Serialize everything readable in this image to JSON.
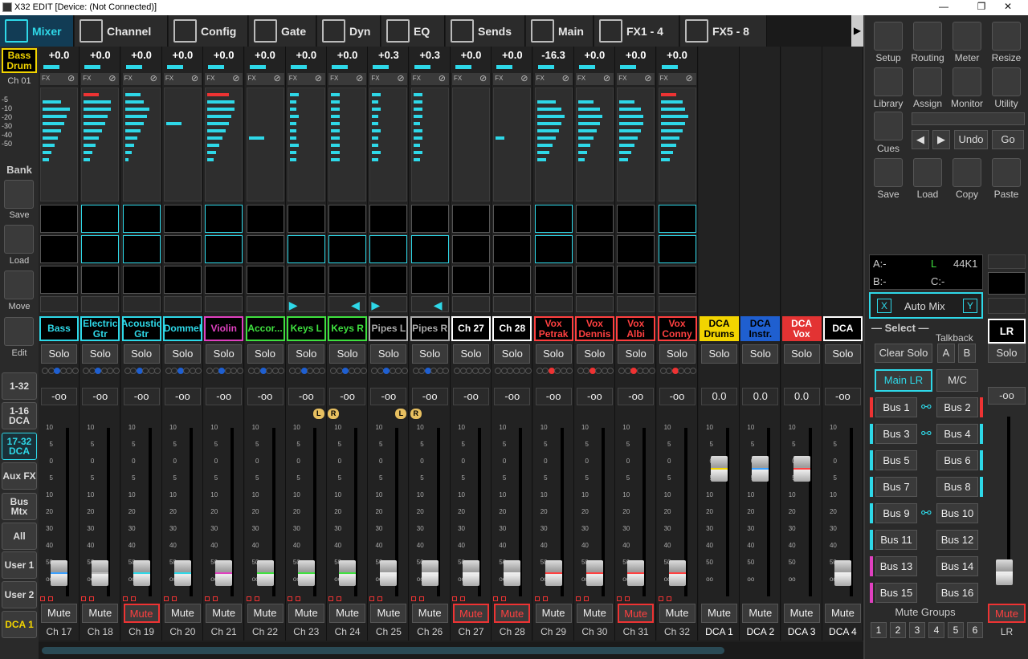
{
  "window": {
    "title": "X32 EDIT [Device: (Not Connected)]"
  },
  "tabs": [
    {
      "label": "Mixer",
      "icon": "mixer-icon",
      "active": true
    },
    {
      "label": "Channel",
      "icon": "channel-icon",
      "active": false
    },
    {
      "label": "Config",
      "icon": "config-icon",
      "active": false
    },
    {
      "label": "Gate",
      "icon": "gate-icon",
      "active": false
    },
    {
      "label": "Dyn",
      "icon": "dyn-icon",
      "active": false
    },
    {
      "label": "EQ",
      "icon": "eq-icon",
      "active": false
    },
    {
      "label": "Sends",
      "icon": "sends-icon",
      "active": false
    },
    {
      "label": "Main",
      "icon": "main-icon",
      "active": false
    },
    {
      "label": "FX1 - 4",
      "icon": "fx-icon",
      "active": false
    },
    {
      "label": "FX5 - 8",
      "icon": "fx-icon",
      "active": false
    }
  ],
  "left": {
    "selected_name": "Bass Drum",
    "selected_ch": "Ch 01",
    "scale": [
      "-5",
      "-10",
      "-20",
      "-30",
      "-40",
      "-50"
    ],
    "bank_label": "Bank",
    "save_label": "Save",
    "load_label": "Load",
    "move_label": "Move",
    "edit_label": "Edit",
    "banks": [
      "1-32",
      "1-16 DCA",
      "17-32 DCA",
      "Aux FX",
      "Bus Mtx",
      "All",
      "User 1",
      "User 2",
      "DCA 1"
    ]
  },
  "channels": [
    {
      "gain": "+0.0",
      "name": "Bass",
      "color": "#2ed8e8",
      "solo": "Solo",
      "level": "-oo",
      "mute": "Mute",
      "mute_on": false,
      "label": "Ch 17",
      "dot": "b",
      "gate": false,
      "dyn": false,
      "fader": 0.0,
      "fcolor": "#3aa0ff"
    },
    {
      "gain": "+0.0",
      "name": "Electric Gtr",
      "color": "#2ed8e8",
      "solo": "Solo",
      "level": "-oo",
      "mute": "Mute",
      "mute_on": false,
      "label": "Ch 18",
      "dot": "b",
      "gate": true,
      "dyn": true,
      "fader": 0.0,
      "fcolor": "#bbb"
    },
    {
      "gain": "+0.0",
      "name": "Acoustic Gtr",
      "color": "#2ed8e8",
      "solo": "Solo",
      "level": "-oo",
      "mute": "Mute",
      "mute_on": true,
      "label": "Ch 19",
      "dot": "b",
      "gate": true,
      "dyn": true,
      "fader": 0.0,
      "fcolor": "#2ed8e8"
    },
    {
      "gain": "+0.0",
      "name": "Dommel",
      "color": "#2ed8e8",
      "solo": "Solo",
      "level": "-oo",
      "mute": "Mute",
      "mute_on": false,
      "label": "Ch 20",
      "dot": "b",
      "gate": false,
      "dyn": false,
      "fader": 0.0,
      "fcolor": "#2ed8e8"
    },
    {
      "gain": "+0.0",
      "name": "Violin",
      "color": "#e040c0",
      "solo": "Solo",
      "level": "-oo",
      "mute": "Mute",
      "mute_on": false,
      "label": "Ch 21",
      "dot": "b",
      "gate": true,
      "dyn": true,
      "fader": 0.0,
      "fcolor": "#e040c0"
    },
    {
      "gain": "+0.0",
      "name": "Accor...",
      "color": "#3fe03f",
      "solo": "Solo",
      "level": "-oo",
      "mute": "Mute",
      "mute_on": false,
      "label": "Ch 22",
      "dot": "b",
      "gate": false,
      "dyn": false,
      "fader": 0.0,
      "fcolor": "#3fe03f"
    },
    {
      "gain": "+0.0",
      "name": "Keys L",
      "color": "#3fe03f",
      "solo": "Solo",
      "level": "-oo",
      "mute": "Mute",
      "mute_on": false,
      "label": "Ch 23",
      "dot": "b",
      "gate": false,
      "dyn": true,
      "fader": 0.0,
      "fcolor": "#3fe03f"
    },
    {
      "gain": "+0.0",
      "name": "Keys R",
      "color": "#3fe03f",
      "solo": "Solo",
      "level": "-oo",
      "mute": "Mute",
      "mute_on": false,
      "label": "Ch 24",
      "dot": "b",
      "gate": false,
      "dyn": true,
      "fader": 0.0,
      "fcolor": "#3fe03f"
    },
    {
      "gain": "+0.3",
      "name": "Pipes L",
      "color": "#aaaaaa",
      "solo": "Solo",
      "level": "-oo",
      "mute": "Mute",
      "mute_on": false,
      "label": "Ch 25",
      "dot": "b",
      "gate": false,
      "dyn": true,
      "fader": 0.0,
      "fcolor": "#eee"
    },
    {
      "gain": "+0.3",
      "name": "Pipes R",
      "color": "#aaaaaa",
      "solo": "Solo",
      "level": "-oo",
      "mute": "Mute",
      "mute_on": false,
      "label": "Ch 26",
      "dot": "b",
      "gate": false,
      "dyn": true,
      "fader": 0.0,
      "fcolor": "#eee"
    },
    {
      "gain": "+0.0",
      "name": "Ch 27",
      "color": "#ffffff",
      "solo": "Solo",
      "level": "-oo",
      "mute": "Mute",
      "mute_on": true,
      "label": "Ch 27",
      "dot": "",
      "gate": false,
      "dyn": false,
      "fader": 0.0,
      "fcolor": "#eee"
    },
    {
      "gain": "+0.0",
      "name": "Ch 28",
      "color": "#ffffff",
      "solo": "Solo",
      "level": "-oo",
      "mute": "Mute",
      "mute_on": true,
      "label": "Ch 28",
      "dot": "",
      "gate": false,
      "dyn": false,
      "fader": 0.0,
      "fcolor": "#eee"
    },
    {
      "gain": "-16.3",
      "name": "Vox Petrak",
      "color": "#ff4040",
      "solo": "Solo",
      "level": "-oo",
      "mute": "Mute",
      "mute_on": false,
      "label": "Ch 29",
      "dot": "r",
      "gate": true,
      "dyn": true,
      "fader": 0.0,
      "fcolor": "#ff4040"
    },
    {
      "gain": "+0.0",
      "name": "Vox Dennis",
      "color": "#ff4040",
      "solo": "Solo",
      "level": "-oo",
      "mute": "Mute",
      "mute_on": false,
      "label": "Ch 30",
      "dot": "r",
      "gate": false,
      "dyn": false,
      "fader": 0.0,
      "fcolor": "#ff4040"
    },
    {
      "gain": "+0.0",
      "name": "Vox Albi",
      "color": "#ff4040",
      "solo": "Solo",
      "level": "-oo",
      "mute": "Mute",
      "mute_on": true,
      "label": "Ch 31",
      "dot": "r",
      "gate": false,
      "dyn": false,
      "fader": 0.0,
      "fcolor": "#ff4040"
    },
    {
      "gain": "+0.0",
      "name": "Vox Conny",
      "color": "#ff4040",
      "solo": "Solo",
      "level": "-oo",
      "mute": "Mute",
      "mute_on": false,
      "label": "Ch 32",
      "dot": "r",
      "gate": true,
      "dyn": true,
      "fader": 0.0,
      "fcolor": "#ff4040"
    }
  ],
  "dcas": [
    {
      "name": "DCA Drums",
      "bg": "#f2d400",
      "fg": "#000000",
      "solo": "Solo",
      "level": "0.0",
      "mute": "Mute",
      "label": "DCA 1",
      "fcolor": "#f2d400"
    },
    {
      "name": "DCA Instr.",
      "bg": "#1f5fd0",
      "fg": "#000000",
      "solo": "Solo",
      "level": "0.0",
      "mute": "Mute",
      "label": "DCA 2",
      "fcolor": "#3aa0ff"
    },
    {
      "name": "DCA Vox",
      "bg": "#e33333",
      "fg": "#ffffff",
      "solo": "Solo",
      "level": "0.0",
      "mute": "Mute",
      "label": "DCA 3",
      "fcolor": "#ff4040"
    },
    {
      "name": "DCA",
      "bg": "#000000",
      "fg": "#ffffff",
      "solo": "Solo",
      "level": "-oo",
      "mute": "Mute",
      "label": "DCA 4",
      "fcolor": "#eee"
    }
  ],
  "fader_scale": [
    "10",
    "5",
    "0",
    "5",
    "10",
    "20",
    "30",
    "40",
    "50",
    "oo"
  ],
  "right": {
    "tools": [
      [
        "Setup",
        "Routing",
        "Meter",
        "Resize"
      ],
      [
        "Library",
        "Assign",
        "Monitor",
        "Utility"
      ]
    ],
    "cues": "Cues",
    "undo": "Undo",
    "go": "Go",
    "files": [
      "Save",
      "Load",
      "Copy",
      "Paste"
    ],
    "a_label": "A:-",
    "l_label": "L",
    "rate": "44K1",
    "b_label": "B:-",
    "c_label": "C:-",
    "automix_x": "X",
    "automix": "Auto Mix",
    "automix_y": "Y",
    "select": "Select",
    "talkback": "Talkback",
    "clear_solo": "Clear Solo",
    "a": "A",
    "b": "B",
    "main_lr": "Main LR",
    "mc": "M/C",
    "buses": [
      "Bus 1",
      "Bus 2",
      "Bus 3",
      "Bus 4",
      "Bus 5",
      "Bus 6",
      "Bus 7",
      "Bus 8",
      "Bus 9",
      "Bus 10",
      "Bus 11",
      "Bus 12",
      "Bus 13",
      "Bus 14",
      "Bus 15",
      "Bus 16"
    ],
    "mute_groups": "Mute Groups",
    "mg": [
      "1",
      "2",
      "3",
      "4",
      "5",
      "6"
    ],
    "lr_name": "LR",
    "lr_solo": "Solo",
    "lr_level": "-oo",
    "lr_mute": "Mute",
    "lr_label": "LR"
  }
}
